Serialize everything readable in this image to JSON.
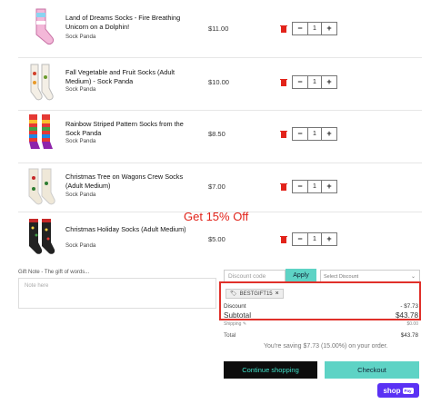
{
  "cart": {
    "items": [
      {
        "name": "Land of Dreams Socks - Fire Breathing Unicorn on a Dolphin!",
        "vendor": "Sock Panda",
        "price": "$11.00",
        "qty": "1"
      },
      {
        "name": "Fall Vegetable and Fruit Socks (Adult Medium) - Sock Panda",
        "vendor": "Sock Panda",
        "price": "$10.00",
        "qty": "1"
      },
      {
        "name": "Rainbow Striped Pattern Socks from the Sock Panda",
        "vendor": "Sock Panda",
        "price": "$8.50",
        "qty": "1"
      },
      {
        "name": "Christmas Tree on Wagons Crew Socks (Adult Medium)",
        "vendor": "Sock Panda",
        "price": "$7.00",
        "qty": "1"
      },
      {
        "name": "Christmas Holiday Socks (Adult Medium)",
        "vendor": "Sock Panda",
        "price": "$5.00",
        "qty": "1"
      }
    ],
    "minus": "−",
    "plus": "+"
  },
  "promo_banner": "Get 15% Off",
  "gift": {
    "label": "Gift Note - The gift of words...",
    "placeholder": "Note here"
  },
  "discount": {
    "placeholder": "Discount code",
    "apply": "Apply",
    "select": "Select Discount",
    "applied_code": "BESTGIFT15",
    "remove": "×"
  },
  "summary": {
    "discount_label": "Discount",
    "discount_value": "- $7.73",
    "subtotal_label": "Subtotal",
    "subtotal_value": "$43.78",
    "shipping_label": "Shipping",
    "shipping_value": "$0.00",
    "total_label": "Total",
    "total_value": "$43.78",
    "saving": "You're saving $7.73 (15.00%) on your order."
  },
  "buttons": {
    "continue": "Continue shopping",
    "checkout": "Checkout",
    "shop": "shop",
    "pay": "Pay"
  },
  "colors": {
    "accent": "#5ed3c5",
    "highlight": "#e0302a",
    "promo": "#e2231a",
    "shop_pay": "#5a31f4"
  }
}
